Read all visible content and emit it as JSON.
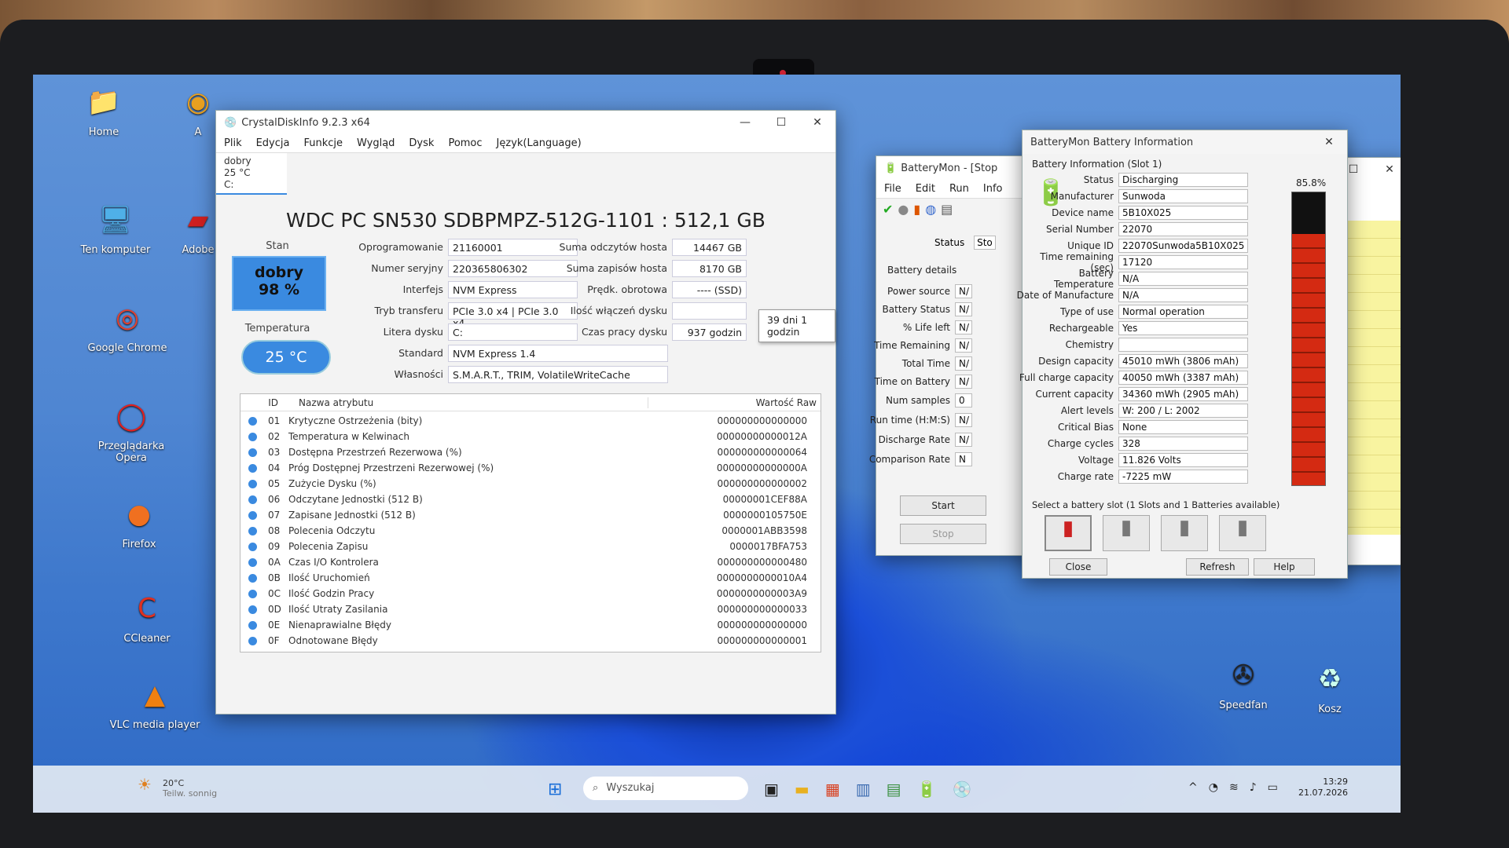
{
  "desktop": {
    "icons": [
      "Home",
      "A",
      "Ten komputer",
      "Adobe",
      "Google Chrome",
      "Przeglądarka Opera",
      "Firefox",
      "CCleaner",
      "VLC media player",
      "Speedfan",
      "Kosz"
    ]
  },
  "crystal": {
    "title": "CrystalDiskInfo 9.2.3 x64",
    "menu": [
      "Plik",
      "Edycja",
      "Funkcje",
      "Wygląd",
      "Dysk",
      "Pomoc",
      "Język(Language)"
    ],
    "tab": {
      "status": "dobry",
      "temp": "25 °C",
      "letter": "C:"
    },
    "disk_title": "WDC PC SN530 SDBPMPZ-512G-1101 : 512,1 GB",
    "stan_label": "Stan",
    "health_word": "dobry",
    "health_pct": "98 %",
    "temp_label": "Temperatura",
    "temp_value": "25 °C",
    "left_fields": [
      {
        "label": "Oprogramowanie",
        "value": "21160001"
      },
      {
        "label": "Numer seryjny",
        "value": "220365806302"
      },
      {
        "label": "Interfejs",
        "value": "NVM Express"
      },
      {
        "label": "Tryb transferu",
        "value": "PCIe 3.0 x4 | PCIe 3.0 x4"
      },
      {
        "label": "Litera dysku",
        "value": "C:"
      },
      {
        "label": "Standard",
        "value": "NVM Express 1.4"
      },
      {
        "label": "Własności",
        "value": "S.M.A.R.T., TRIM, VolatileWriteCache"
      }
    ],
    "right_fields": [
      {
        "label": "Suma odczytów hosta",
        "value": "14467 GB"
      },
      {
        "label": "Suma zapisów hosta",
        "value": "8170 GB"
      },
      {
        "label": "Prędk. obrotowa",
        "value": "---- (SSD)"
      },
      {
        "label": "Ilość włączeń dysku",
        "value": ""
      },
      {
        "label": "Czas pracy dysku",
        "value": "937 godzin"
      }
    ],
    "tooltip": "39 dni 1 godzin",
    "table_headers": {
      "id": "ID",
      "name": "Nazwa atrybutu",
      "raw": "Wartość Raw"
    },
    "attributes": [
      [
        "01",
        "Krytyczne Ostrzeżenia (bity)",
        "000000000000000"
      ],
      [
        "02",
        "Temperatura w Kelwinach",
        "00000000000012A"
      ],
      [
        "03",
        "Dostępna Przestrzeń Rezerwowa (%)",
        "000000000000064"
      ],
      [
        "04",
        "Próg Dostępnej Przestrzeni Rezerwowej (%)",
        "00000000000000A"
      ],
      [
        "05",
        "Zużycie Dysku (%)",
        "000000000000002"
      ],
      [
        "06",
        "Odczytane Jednostki (512 B)",
        "00000001CEF88A"
      ],
      [
        "07",
        "Zapisane Jednostki (512 B)",
        "0000000105750E"
      ],
      [
        "08",
        "Polecenia Odczytu",
        "0000001ABB3598"
      ],
      [
        "09",
        "Polecenia Zapisu",
        "0000017BFA753"
      ],
      [
        "0A",
        "Czas I/O Kontrolera",
        "000000000000480"
      ],
      [
        "0B",
        "Ilość Uruchomień",
        "0000000000010A4"
      ],
      [
        "0C",
        "Ilość Godzin Pracy",
        "0000000000003A9"
      ],
      [
        "0D",
        "Ilość Utraty Zasilania",
        "000000000000033"
      ],
      [
        "0E",
        "Nienaprawialne Błędy",
        "000000000000000"
      ],
      [
        "0F",
        "Odnotowane Błędy",
        "000000000000001"
      ]
    ]
  },
  "batterymon": {
    "title": "BatteryMon - [Stop",
    "menu": [
      "File",
      "Edit",
      "Run",
      "Info"
    ],
    "status_label": "Status",
    "status_value": "Sto",
    "group": "Battery details",
    "fields": [
      "Power source",
      "Battery Status",
      "% Life left",
      "Time Remaining",
      "Total Time",
      "Time on Battery",
      "Num samples",
      "Run time (H:M:S)",
      "Discharge Rate",
      "Comparison Rate"
    ],
    "values": [
      "N/",
      "N/",
      "N/",
      "N/",
      "N/",
      "N/",
      "0",
      "N/",
      "N/",
      "N"
    ],
    "start": "Start",
    "stop": "Stop"
  },
  "batinfo": {
    "title": "BatteryMon Battery Information",
    "group": "Battery Information (Slot 1)",
    "pct": "85.8%",
    "fields": [
      [
        "Status",
        "Discharging"
      ],
      [
        "Manufacturer",
        "Sunwoda"
      ],
      [
        "Device name",
        "5B10X025"
      ],
      [
        "Serial Number",
        "22070"
      ],
      [
        "Unique ID",
        "22070Sunwoda5B10X025"
      ],
      [
        "Time remaining (sec)",
        "17120"
      ],
      [
        "Battery Temperature",
        "N/A"
      ],
      [
        "Date of Manufacture",
        "N/A"
      ],
      [
        "Type of use",
        "Normal operation"
      ],
      [
        "Rechargeable",
        "Yes"
      ],
      [
        "Chemistry",
        ""
      ],
      [
        "Design capacity",
        "45010 mWh (3806 mAh)"
      ],
      [
        "Full charge capacity",
        "40050 mWh (3387 mAh)"
      ],
      [
        "Current capacity",
        "34360 mWh (2905 mAh)"
      ],
      [
        "Alert levels",
        "W: 200 / L: 2002"
      ],
      [
        "Critical Bias",
        "None"
      ],
      [
        "Charge cycles",
        "328"
      ],
      [
        "Voltage",
        "11.826 Volts"
      ],
      [
        "Charge rate",
        "-7225 mW"
      ]
    ],
    "slot_label": "Select a battery slot (1 Slots and 1 Batteries available)",
    "buttons": [
      "Close",
      "Refresh",
      "Help"
    ]
  },
  "taskbar": {
    "weather_temp": "20°C",
    "weather_desc": "Teilw. sonnig",
    "search": "Wyszukaj",
    "time": "13:29",
    "date": "21.07.2026"
  },
  "colors": {
    "health": "#3a8ae0",
    "battery_red": "#d42a12"
  }
}
